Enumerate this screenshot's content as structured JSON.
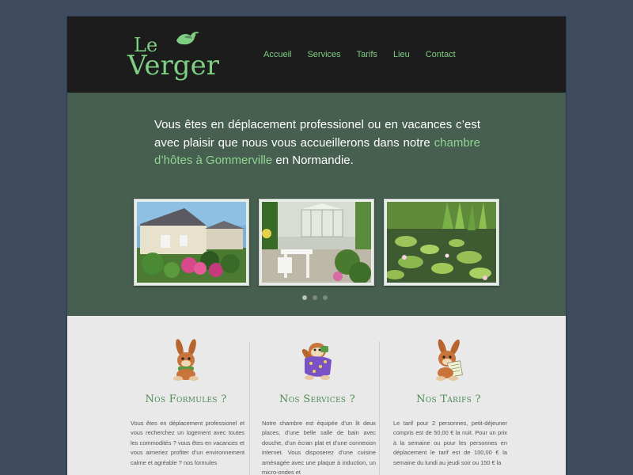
{
  "logo": {
    "le": "Le",
    "verger": "Verger"
  },
  "nav": [
    "Accueil",
    "Services",
    "Tarifs",
    "Lieu",
    "Contact"
  ],
  "hero": {
    "line1": "Vous êtes en déplacement professionel ou en vacances c’est avec plaisir que nous vous accueillerons dans notre",
    "link": "chambre d’hôtes à Gommerville",
    "line_end": "en Normandie."
  },
  "slider": {
    "photos": [
      "house-photo",
      "patio-photo",
      "pond-photo"
    ],
    "dots": 3,
    "active_dot": 1
  },
  "columns": [
    {
      "title": "Nos Formules ?",
      "icon": "rabbit-scarf-icon",
      "text": "Vous êtes en déplacement professionel et vous recherchez un logement avec toutes les commodités ? vous êtes en vacances et vous aimeriez profiter d’un environnement calme et agréable ? nos formules"
    },
    {
      "title": "Nos Services ?",
      "icon": "rabbit-blanket-icon",
      "text": "Notre chambre est équipée d’un lit deux places, d’une belle salle de bain avec douche, d’un écran plat et d’une connexion internet. Vous disposerez d’une cuisine aménagée avec une plaque à induction, un micro-ondes et"
    },
    {
      "title": "Nos Tarifs ?",
      "icon": "rabbit-paper-icon",
      "text": "Le tarif pour 2 personnes, petit-déjeuner compris est de 50,00 € la nuit. Pour un prix à la semaine ou pour les personnes en déplacement le tarif est de 100,00 € la semaine du lundi au jeudi soir ou 150 € la"
    }
  ],
  "colors": {
    "accent": "#7fcf83",
    "hero_bg": "#475f50",
    "header_bg": "#1c1c1c",
    "body_bg": "#3e4a5e"
  }
}
